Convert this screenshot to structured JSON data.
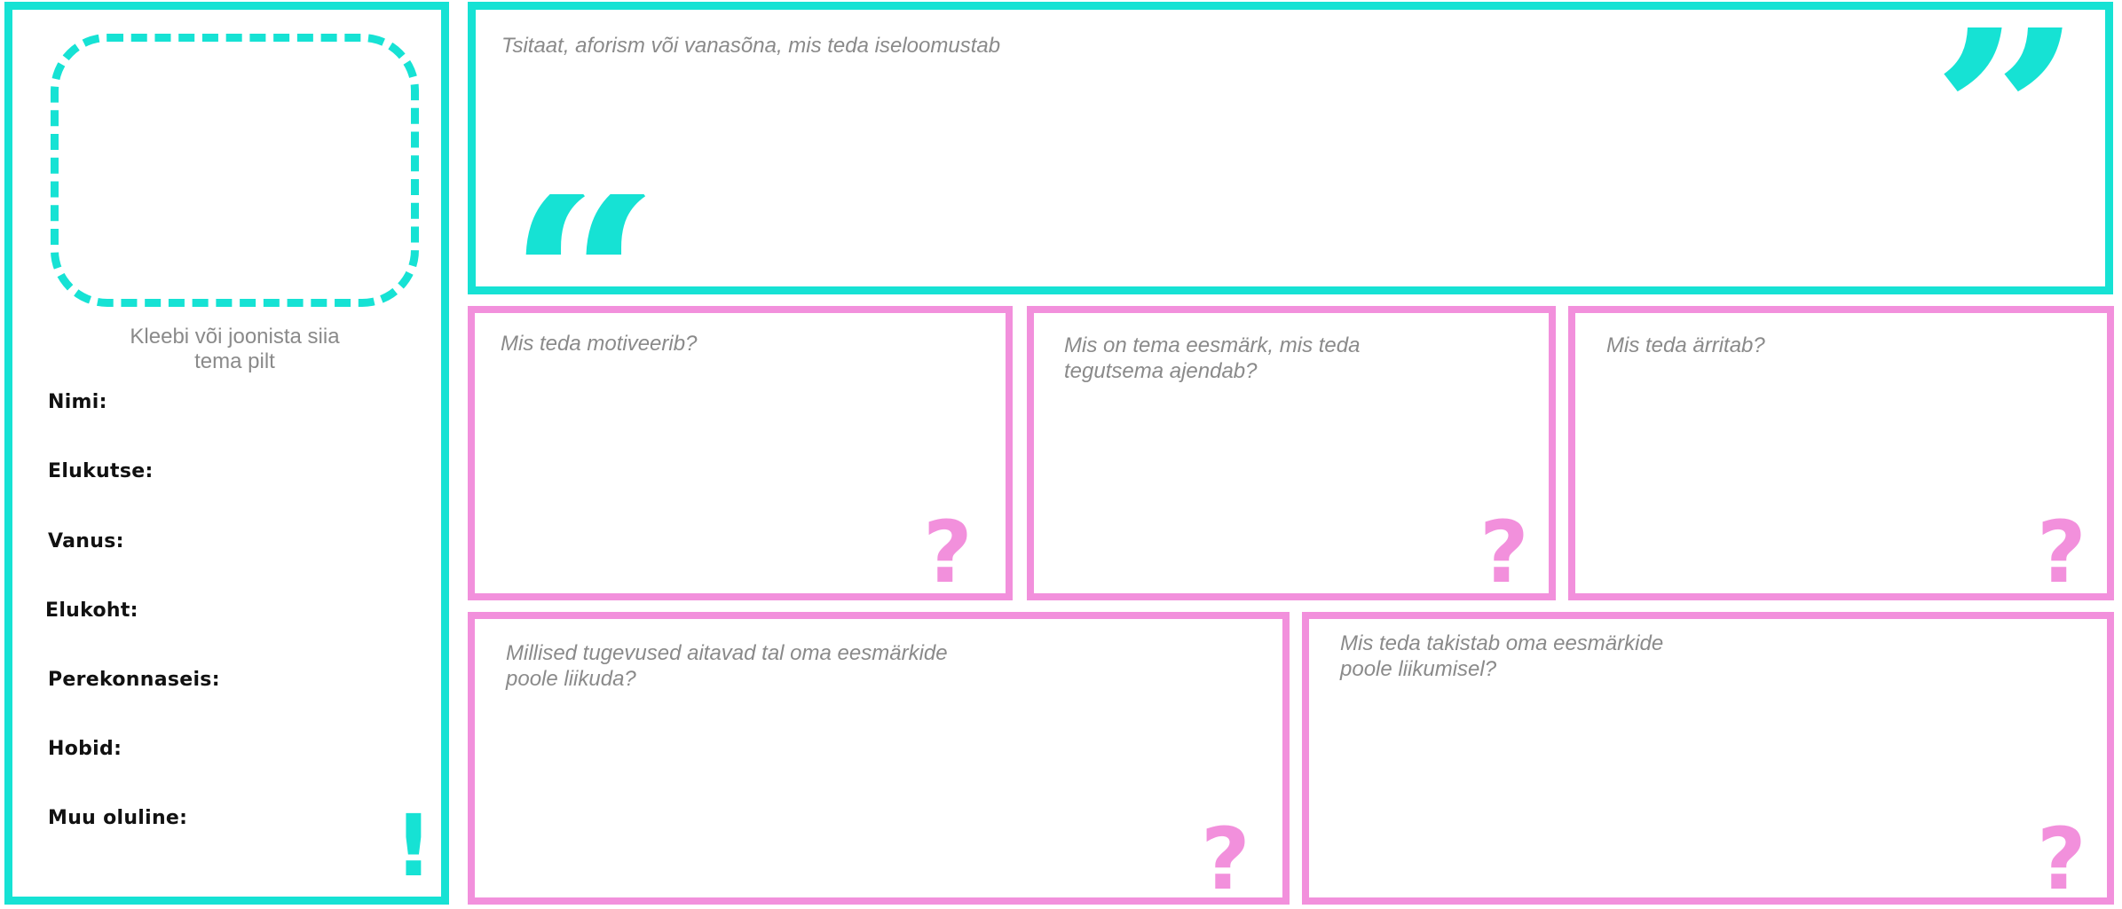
{
  "profile": {
    "photo_hint": "Kleebi või joonista siia\ntema pilt",
    "fields": [
      "Nimi:",
      "Elukutse:",
      "Vanus:",
      "Elukoht:",
      "Perekonnaseis:",
      "Hobid:",
      "Muu oluline:"
    ],
    "mark": "!"
  },
  "quote": {
    "prompt": "Tsitaat, aforism või vanasõna, mis teda iseloomustab",
    "open_glyph": "“",
    "close_glyph": "”"
  },
  "boxes": {
    "motivation": "Mis teda motiveerib?",
    "goal": "Mis on tema eesmärk, mis teda\ntegutsema ajendab?",
    "irritation": "Mis teda ärritab?",
    "strengths": "Millised tugevused aitavad tal oma eesmärkide\npoole liikuda?",
    "obstacles": "Mis teda takistab oma eesmärkide\npoole liikumisel?"
  },
  "question_mark": "?",
  "colors": {
    "accent_teal": "#16e2d4",
    "accent_pink": "#f290dc",
    "prompt_gray": "#8a8a8a"
  }
}
